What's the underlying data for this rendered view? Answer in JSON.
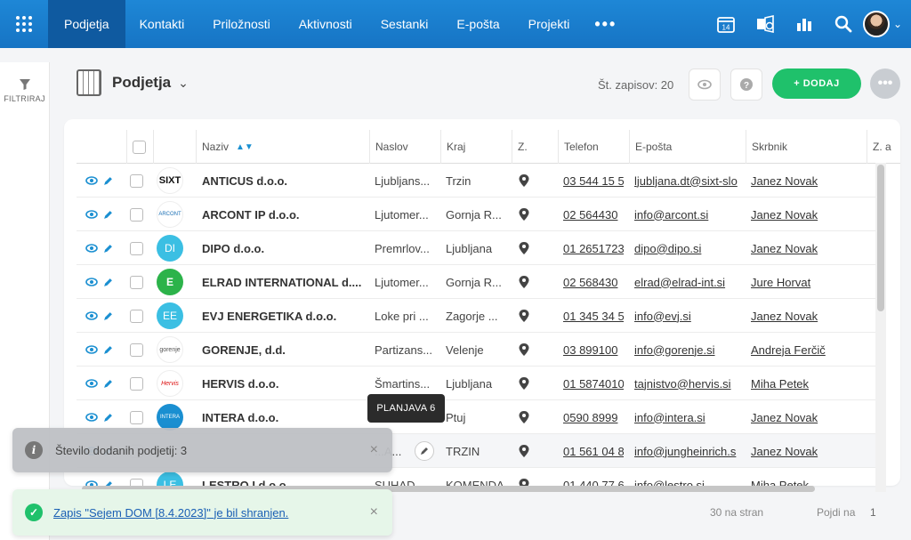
{
  "nav": {
    "items": [
      "Podjetja",
      "Kontakti",
      "Priložnosti",
      "Aktivnosti",
      "Sestanki",
      "E-pošta",
      "Projekti"
    ],
    "more": "•••",
    "calendar_day": "14"
  },
  "sidebar": {
    "filter_label": "FILTRIRAJ"
  },
  "header": {
    "title": "Podjetja",
    "record_count": "Št. zapisov: 20",
    "add_label": "+ DODAJ",
    "more": "•••"
  },
  "table": {
    "columns": [
      "Naziv",
      "Naslov",
      "Kraj",
      "Z.",
      "Telefon",
      "E-pošta",
      "Skrbnik",
      "Z. a"
    ],
    "rows": [
      {
        "name": "ANTICUS d.o.o.",
        "address": "Ljubljans...",
        "city": "Trzin",
        "phone": "03 544 15 5",
        "email": "ljubljana.dt@sixt-slo",
        "owner": "Janez Novak",
        "logo": "SIXT"
      },
      {
        "name": "ARCONT IP d.o.o.",
        "address": "Ljutomer...",
        "city": "Gornja R...",
        "phone": "02 564430",
        "email": "info@arcont.si",
        "owner": "Janez Novak",
        "logo": "ARCONT"
      },
      {
        "name": "DIPO d.o.o.",
        "address": "Premrlov...",
        "city": "Ljubljana",
        "phone": "01 2651723",
        "email": "dipo@dipo.si",
        "owner": "Janez Novak",
        "logo": "DI"
      },
      {
        "name": "ELRAD INTERNATIONAL d....",
        "address": "Ljutomer...",
        "city": "Gornja R...",
        "phone": "02 568430",
        "email": "elrad@elrad-int.si",
        "owner": "Jure Horvat",
        "logo": "E"
      },
      {
        "name": "EVJ ENERGETIKA d.o.o.",
        "address": "Loke pri ...",
        "city": "Zagorje ...",
        "phone": "01 345 34 5",
        "email": "info@evj.si",
        "owner": "Janez Novak",
        "logo": "EE"
      },
      {
        "name": "GORENJE, d.d.",
        "address": "Partizans...",
        "city": "Velenje",
        "phone": "03 899100",
        "email": "info@gorenje.si",
        "owner": "Andreja Ferčič",
        "logo": "gorenje"
      },
      {
        "name": "HERVIS d.o.o.",
        "address": "Šmartins...",
        "city": "Ljubljana",
        "phone": "01 5874010",
        "email": "tajnistvo@hervis.si",
        "owner": "Miha Petek",
        "logo": "Hervis"
      },
      {
        "name": "INTERA d.o.o.",
        "address": "",
        "city": "Ptuj",
        "phone": "0590 8999",
        "email": "info@intera.si",
        "owner": "Janez Novak",
        "logo": "INTERA"
      },
      {
        "name": "",
        "address": "...A...",
        "city": "TRZIN",
        "phone": "01 561 04 8",
        "email": "info@jungheinrich.s",
        "owner": "Janez Novak",
        "logo": ""
      },
      {
        "name": "LESTRO I d.o.o.",
        "address": "SUHAD...",
        "city": "KOMENDA",
        "phone": "01 440 77 6",
        "email": "info@lestro.si",
        "owner": "Miha Petek",
        "logo": "LE"
      }
    ]
  },
  "tooltip": "PLANJAVA 6",
  "toasts": {
    "info": "Število dodanih podjetij: 3",
    "success": "Zapis \"Sejem DOM [8.4.2023]\" je bil shranjen.",
    "close": "×"
  },
  "pagination": {
    "per_page": "30 na stran",
    "goto_label": "Pojdi na",
    "page": "1"
  },
  "colors": {
    "nav": "#1674c4",
    "nav_active": "#0f5aa0",
    "add_button": "#1fc16b",
    "action_icon": "#1a8fd1"
  }
}
